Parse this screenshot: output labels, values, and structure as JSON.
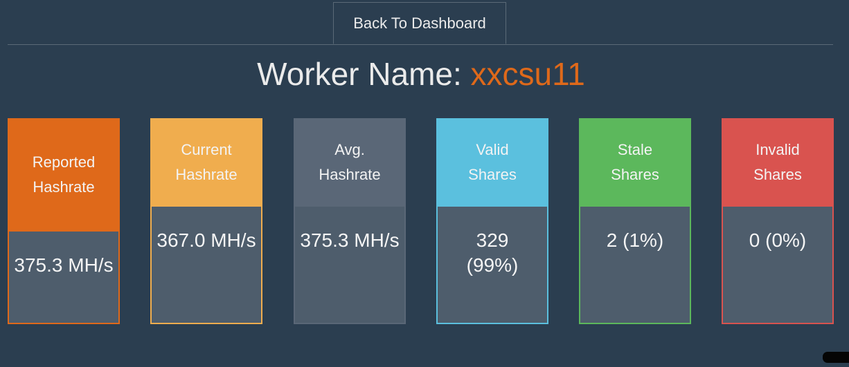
{
  "nav": {
    "back_label": "Back To Dashboard"
  },
  "header": {
    "prefix": "Worker Name:",
    "worker_name": "xxcsu11"
  },
  "cards": [
    {
      "label": "Reported Hashrate",
      "value": "375.3 MH/s",
      "color": "#df691a"
    },
    {
      "label": "Current Hashrate",
      "value": "367.0 MH/s",
      "color": "#f0ad4e"
    },
    {
      "label": "Avg. Hashrate",
      "value": "375.3 MH/s",
      "color": "#5a6777"
    },
    {
      "label": "Valid Shares",
      "value": "329 (99%)",
      "color": "#5bc0de"
    },
    {
      "label": "Stale Shares",
      "value": "2 (1%)",
      "color": "#5cb85c"
    },
    {
      "label": "Invalid Shares",
      "value": "0 (0%)",
      "color": "#d9534f"
    }
  ]
}
